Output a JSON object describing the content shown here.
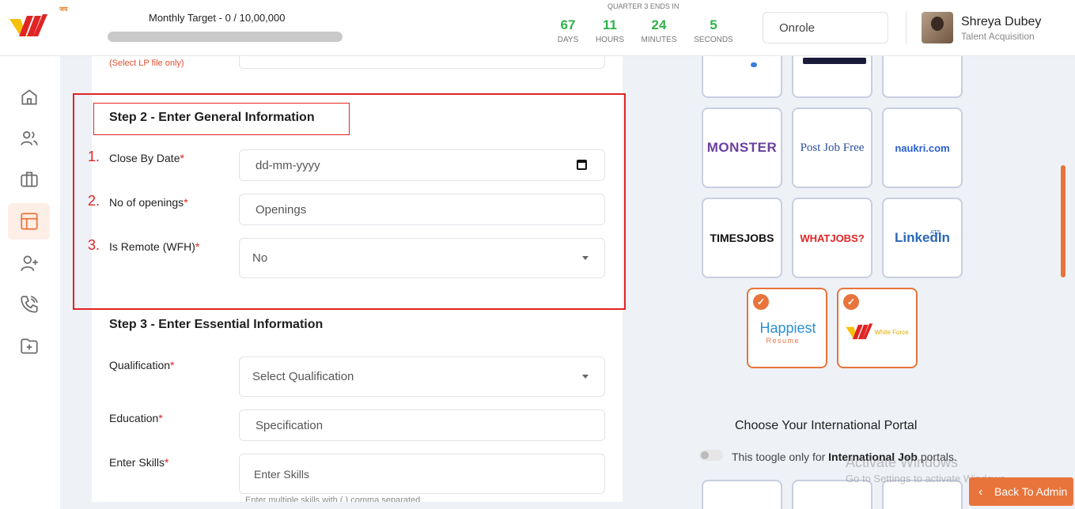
{
  "header": {
    "logo_text": "W",
    "logo_badge": "जय",
    "monthly_target_label": "Monthly Target  -  0 / 10,00,000",
    "monthly_target_progress": 0,
    "countdown_title": "QUARTER 3 ENDS IN",
    "countdown": [
      {
        "value": "67",
        "unit": "DAYS"
      },
      {
        "value": "11",
        "unit": "HOURS"
      },
      {
        "value": "24",
        "unit": "MINUTES"
      },
      {
        "value": "5",
        "unit": "SECONDS"
      }
    ],
    "company": "Onrole",
    "user_name": "Shreya Dubey",
    "user_role": "Talent Acquisition"
  },
  "sidebar": {
    "items": [
      {
        "icon": "home-icon",
        "active": false
      },
      {
        "icon": "users-icon",
        "active": false
      },
      {
        "icon": "briefcase-icon",
        "active": false
      },
      {
        "icon": "layout-icon",
        "active": true
      },
      {
        "icon": "add-user-icon",
        "active": false
      },
      {
        "icon": "phone-icon",
        "active": false
      },
      {
        "icon": "folder-add-icon",
        "active": false
      }
    ]
  },
  "form": {
    "partial_label": "(Select LP file only)",
    "step2_title": "Step 2 - Enter General Information",
    "close_by_label": "Close By Date",
    "close_by_placeholder": "dd-mm-yyyy",
    "openings_label": "No of openings",
    "openings_placeholder": "Openings",
    "remote_label": "Is Remote (WFH)",
    "remote_value": "No",
    "required_mark": "*",
    "step3_title": "Step 3 - Enter Essential Information",
    "qualification_label": "Qualification",
    "qualification_placeholder": "Select Qualification",
    "education_label": "Education",
    "education_placeholder": "Specification",
    "skills_label": "Enter Skills",
    "skills_placeholder": "Enter Skills",
    "skills_helper": "Enter multiple skills with (,) comma separated"
  },
  "annotations": [
    "1.",
    "2.",
    "3."
  ],
  "portals": {
    "tiles": [
      {
        "name": "MONSTER",
        "selected": false
      },
      {
        "name": "Post Job Free",
        "selected": false
      },
      {
        "name": "naukri.com",
        "selected": false
      },
      {
        "name": "TIMESJOBS",
        "selected": false
      },
      {
        "name": "WHATJOBS?",
        "selected": false
      },
      {
        "name": "LinkedIn",
        "badge": "ATS",
        "selected": false
      },
      {
        "name": "Happiest",
        "sub": "Resume",
        "selected": true
      },
      {
        "name": "White Force",
        "selected": true
      }
    ],
    "international_title": "Choose Your International Portal",
    "toggle_text_prefix": "This toogle only for ",
    "toggle_text_bold": "International Job",
    "toggle_text_suffix": " portals.",
    "international_enabled": false
  },
  "watermark": {
    "line1": "Activate Windows",
    "line2": "Go to Settings to activate Windows."
  },
  "back_button": "Back To Admin",
  "colors": {
    "accent": "#e8743b",
    "countdown": "#2fb34a",
    "annotation": "#e02424"
  }
}
